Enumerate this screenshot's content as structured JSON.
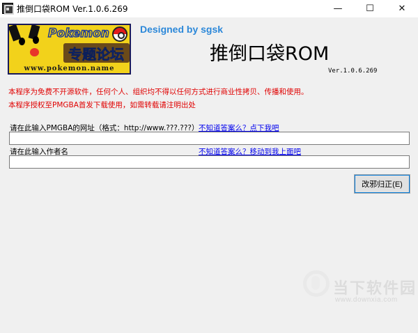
{
  "window": {
    "title": "推倒口袋ROM Ver.1.0.6.269",
    "min_glyph": "—",
    "max_glyph": "☐",
    "close_glyph": "✕"
  },
  "logo": {
    "pokemon_text": "Pokemon",
    "forum_text": "专题论坛",
    "url_text": "www.pokemon.name"
  },
  "header": {
    "designed_by": "Designed by sgsk",
    "title": "推倒口袋ROM",
    "version": "Ver.1.0.6.269"
  },
  "notices": [
    "本程序为免费不开源软件，任何个人、组织均不得以任何方式进行商业性拷贝、传播和使用。",
    "本程序授权至PMGBA首发下载使用，如需转载请注明出处"
  ],
  "form": {
    "url_label": "请在此输入PMGBA的网址（格式：http://www.???.???）",
    "url_help_link": "不知道答案么？点下我吧",
    "url_value": "",
    "author_label": "请在此输入作者名",
    "author_help_link": "不知道答案么？移动到我上面吧",
    "author_value": "",
    "submit_label": "改邪归正(E)"
  },
  "watermark": {
    "brand": "当下软件园",
    "url": "www.downxia.com"
  },
  "colors": {
    "notice": "#e00000",
    "designed_by": "#2c88d9",
    "link": "#0000ee",
    "client_bg": "#f0f0f0"
  }
}
